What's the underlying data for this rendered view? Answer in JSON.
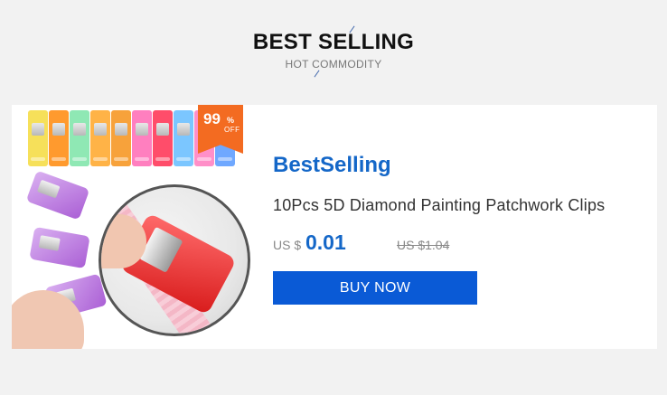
{
  "header": {
    "title": "BEST SELLING",
    "subtitle": "HOT  COMMODITY"
  },
  "product": {
    "image_icon": "product-photo-clips",
    "badge": {
      "number": "99",
      "percent": "%",
      "off": "OFF",
      "color": "#f36b21"
    },
    "brand": "BestSelling",
    "title": "10Pcs 5D Diamond Painting Patchwork Clips",
    "price": {
      "currency": "US $",
      "current": "0.01",
      "original": "US $1.04"
    },
    "button_label": "BUY NOW"
  },
  "colors": {
    "accent": "#1467c8",
    "button": "#0a5ad6",
    "background": "#f2f2f2"
  }
}
